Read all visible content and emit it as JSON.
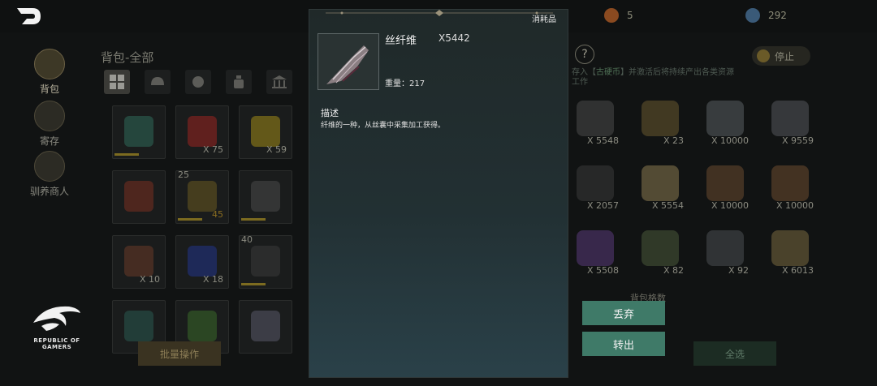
{
  "header": {
    "currency_1_value": "5",
    "currency_2_value": "292"
  },
  "sidebar": {
    "items": [
      {
        "label": "背包",
        "icon": "bag-icon",
        "active": true
      },
      {
        "label": "寄存",
        "icon": "storage-house-icon",
        "active": false
      },
      {
        "label": "驯养商人",
        "icon": "merchant-icon",
        "active": false
      }
    ]
  },
  "bag": {
    "title": "背包-全部",
    "tabs": [
      "all-grid-icon",
      "helmet-icon",
      "ball-icon",
      "potion-icon",
      "bank-icon"
    ],
    "slots_col1": [
      {
        "count": ""
      },
      {
        "count": ""
      },
      {
        "count": "X 10"
      },
      {
        "count": ""
      }
    ],
    "slots_col2": [
      {
        "count": "X 75"
      },
      {
        "level": "25",
        "count": "45"
      },
      {
        "count": "X 18"
      },
      {
        "count": ""
      }
    ],
    "slots_col3": [
      {
        "count": "X 59"
      },
      {
        "count": ""
      },
      {
        "level": "40",
        "count": ""
      },
      {
        "count": ""
      }
    ],
    "batch_button": "批量操作"
  },
  "right_panel": {
    "help": "?",
    "stop_button": "停止",
    "info_prefix": "存入【",
    "info_highlight": "古硬币",
    "info_suffix": "】并激活后将持续产出各类资源",
    "info_line2": "工作",
    "capacity_label": "背包格数",
    "select_all": "全选",
    "items": [
      {
        "count": "X 5548"
      },
      {
        "count": "X 23"
      },
      {
        "count": "X 10000"
      },
      {
        "count": "X 9559"
      },
      {
        "count": "X 2057"
      },
      {
        "count": "X 5554"
      },
      {
        "count": "X 10000"
      },
      {
        "count": "X 10000"
      },
      {
        "count": "X 5508"
      },
      {
        "count": "X 82"
      },
      {
        "count": "X 92"
      },
      {
        "count": "X 6013"
      }
    ]
  },
  "detail": {
    "category": "消耗品",
    "name": "丝纤维",
    "quantity": "X5442",
    "weight": "重量：217",
    "desc_title": "描述",
    "desc_text": "纤维的一种，从丝囊中采集加工获得。",
    "discard_button": "丢弃",
    "transfer_button": "转出"
  },
  "logo": {
    "line1": "REPUBLIC OF",
    "line2": "GAMERS"
  },
  "colors": {
    "popup_top": "#202929",
    "popup_bottom": "#2a4149",
    "action_button": "#3f7a68",
    "gold_text": "#8b7c55"
  }
}
